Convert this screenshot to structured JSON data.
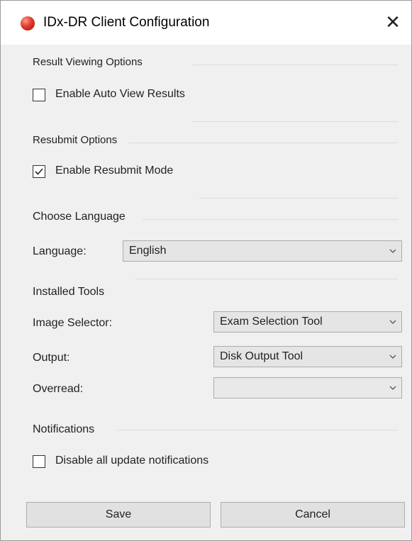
{
  "window": {
    "title": "IDx-DR Client Configuration",
    "close_glyph": "✕"
  },
  "result_viewing": {
    "heading": "Result Viewing Options",
    "auto_view": {
      "label": "Enable Auto View Results",
      "checked": false
    }
  },
  "resubmit": {
    "heading": "Resubmit Options",
    "resubmit_mode": {
      "label": "Enable Resubmit Mode",
      "checked": true
    }
  },
  "language": {
    "heading": "Choose Language",
    "label": "Language:",
    "value": "English"
  },
  "tools": {
    "heading": "Installed Tools",
    "image_selector": {
      "label": "Image Selector:",
      "value": "Exam Selection Tool"
    },
    "output": {
      "label": "Output:",
      "value": "Disk Output Tool"
    },
    "overread": {
      "label": "Overread:",
      "value": ""
    }
  },
  "notifications": {
    "heading": "Notifications",
    "disable_updates": {
      "label": "Disable all update notifications",
      "checked": false
    }
  },
  "buttons": {
    "save": "Save",
    "cancel": "Cancel"
  },
  "icons": {
    "app": "app-logo-icon",
    "close": "close-icon",
    "checkmark": "checkmark-icon",
    "dropdown": "chevron-down-icon"
  },
  "colors": {
    "dialog_bg": "#f0f0f0",
    "titlebar_bg": "#ffffff",
    "app_icon": "#e23a2a"
  }
}
